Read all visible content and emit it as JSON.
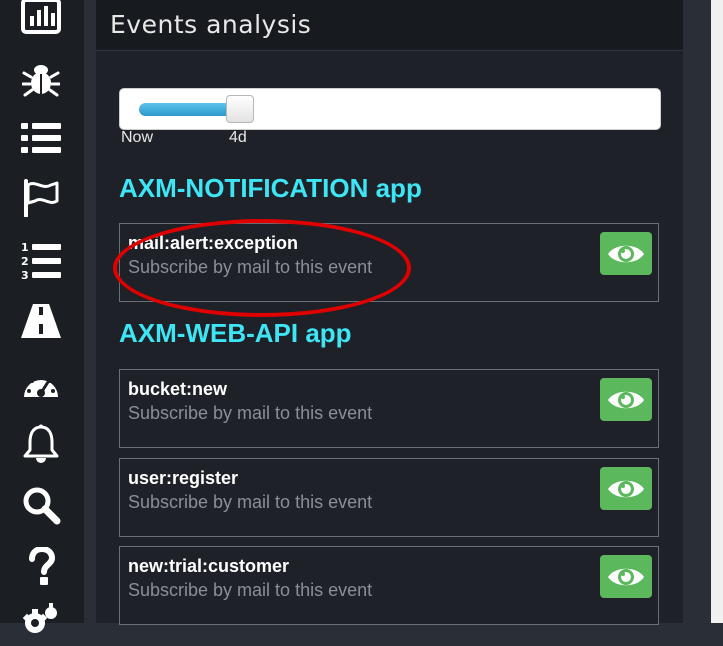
{
  "panel": {
    "title": "Events analysis"
  },
  "slider": {
    "label_left": "Now",
    "label_right": "4d",
    "value_fraction": 0.22
  },
  "apps": [
    {
      "name": "AXM-NOTIFICATION app",
      "events": [
        {
          "name": "mail:alert:exception",
          "subtitle": "Subscribe by mail to this event"
        }
      ]
    },
    {
      "name": "AXM-WEB-API app",
      "events": [
        {
          "name": "bucket:new",
          "subtitle": "Subscribe by mail to this event"
        },
        {
          "name": "user:register",
          "subtitle": "Subscribe by mail to this event"
        },
        {
          "name": "new:trial:customer",
          "subtitle": "Subscribe by mail to this event"
        }
      ]
    }
  ],
  "sidebar": {
    "icons": [
      "dashboard-chart-icon",
      "bug-icon",
      "list-icon",
      "flag-icon",
      "ordered-list-icon",
      "road-icon",
      "speedometer-icon",
      "bell-icon",
      "search-icon",
      "help-icon",
      "settings-icon"
    ]
  },
  "colors": {
    "accent_heading": "#3ee5f5",
    "watch_button": "#5cb85c",
    "annotation": "#e00000",
    "slider_fill": "#2a99c9"
  }
}
